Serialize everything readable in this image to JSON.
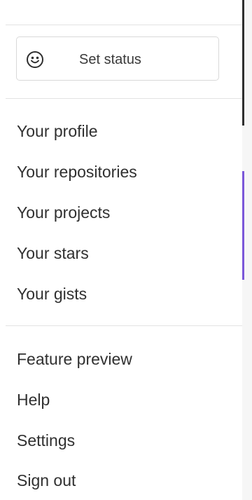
{
  "status_button": {
    "label": "Set status",
    "icon": "smiley-icon"
  },
  "menu_groups": {
    "account": [
      "Your profile",
      "Your repositories",
      "Your projects",
      "Your stars",
      "Your gists"
    ],
    "misc": [
      "Feature preview",
      "Help",
      "Settings",
      "Sign out"
    ]
  },
  "colors": {
    "text": "#303030",
    "divider": "#e3e3e3",
    "button_border": "#d9d9d9",
    "accent_purple": "#7b58d9"
  }
}
